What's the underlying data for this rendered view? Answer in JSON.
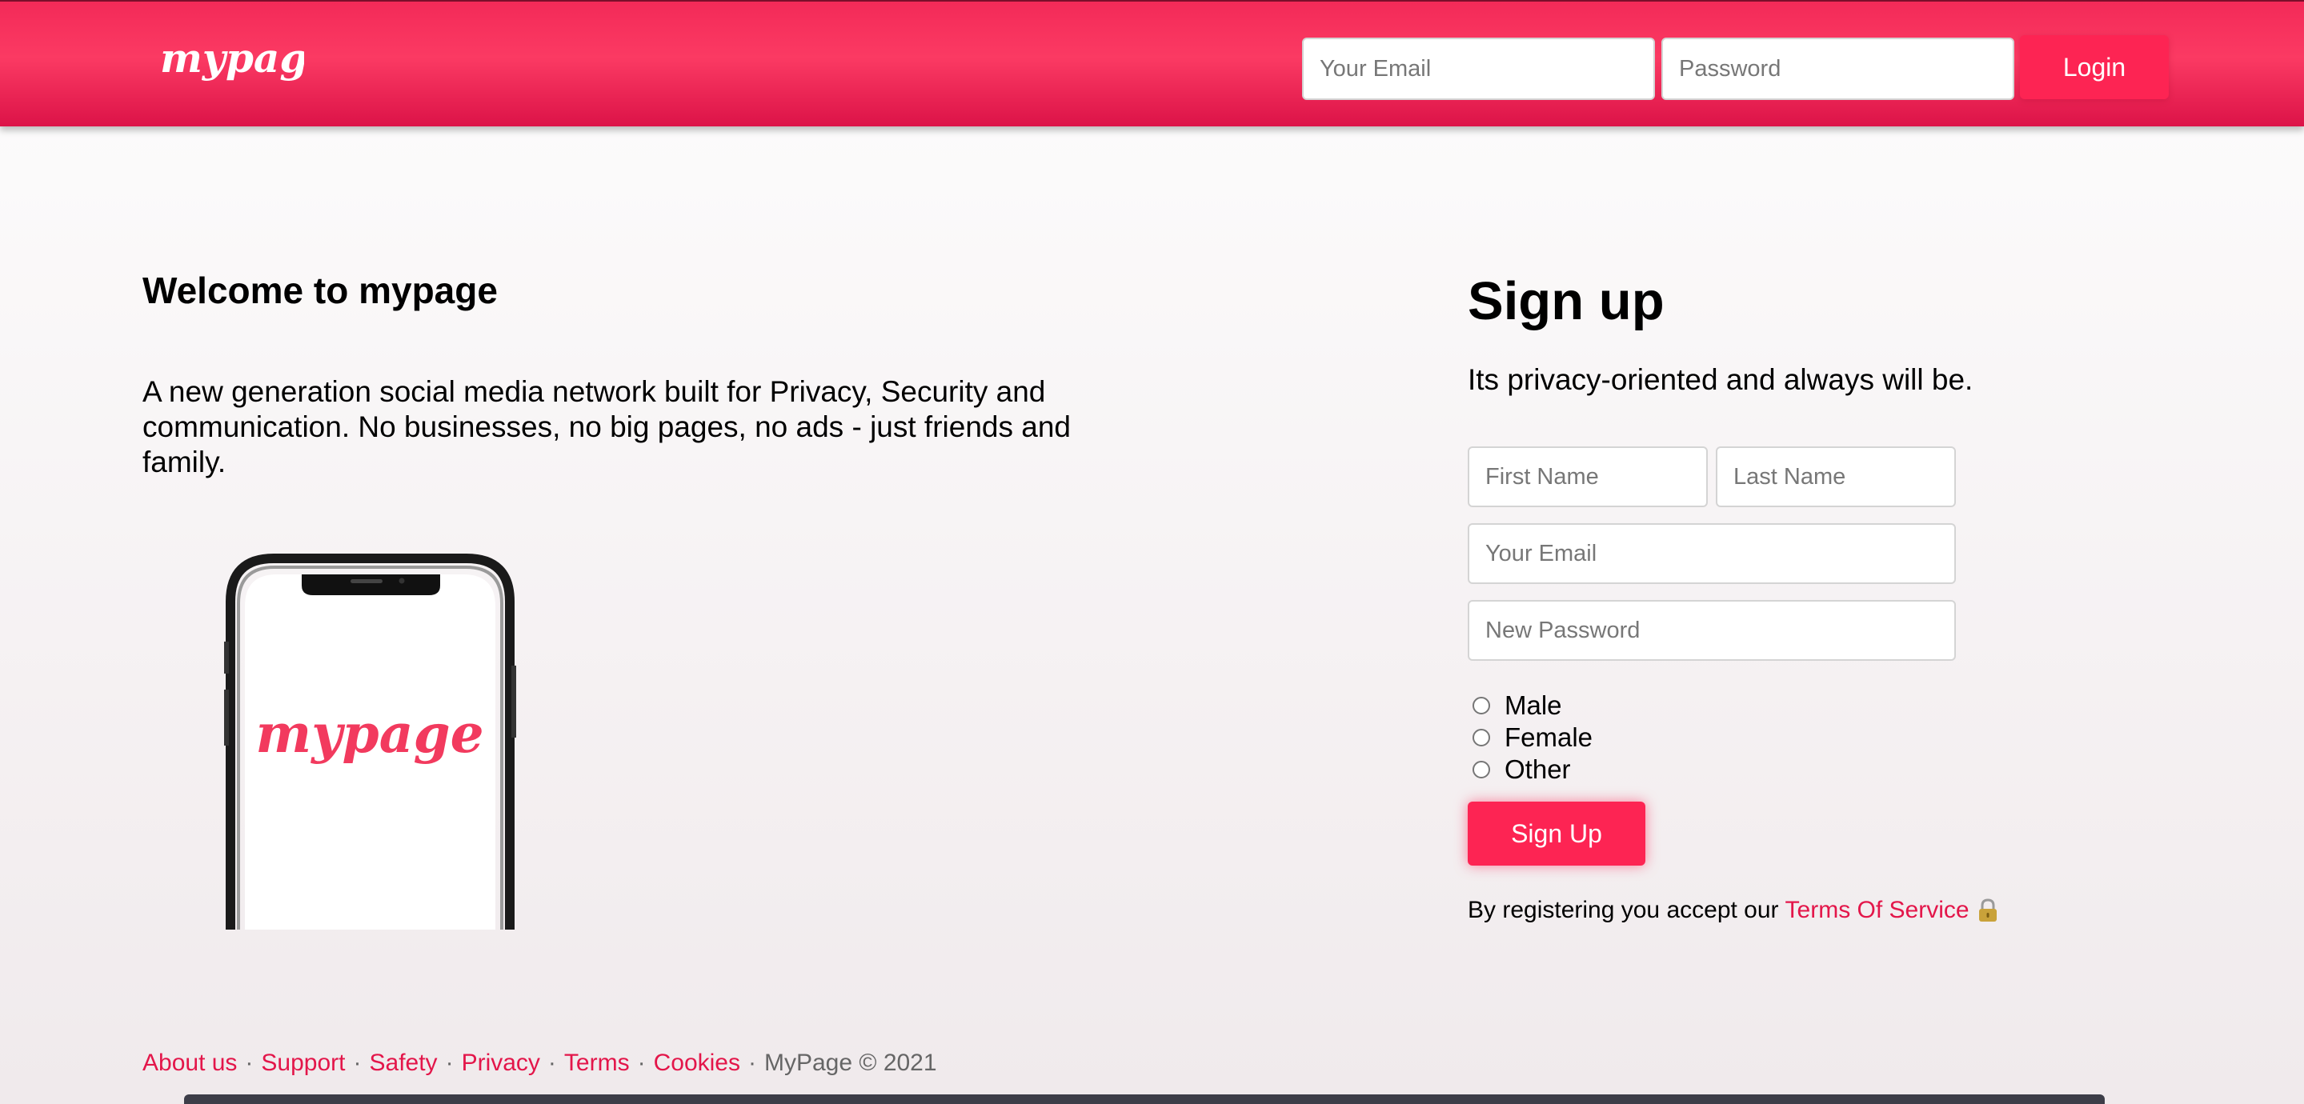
{
  "brand": {
    "logo_text": "mypage",
    "accent": "#fd2453",
    "link_color": "#e3164a",
    "header_color": "#f32a58"
  },
  "header": {
    "email_placeholder": "Your Email",
    "password_placeholder": "Password",
    "login_label": "Login"
  },
  "intro": {
    "title": "Welcome to mypage",
    "text": "A new generation social media network built for Privacy, Security and communication. No businesses, no big pages, no ads - just friends and family.",
    "phone_logo": "mypage"
  },
  "signup": {
    "title": "Sign up",
    "subtitle": "Its privacy-oriented and always will be.",
    "first_name_placeholder": "First Name",
    "last_name_placeholder": "Last Name",
    "email_placeholder": "Your Email",
    "password_placeholder": "New Password",
    "gender_options": [
      "Male",
      "Female",
      "Other"
    ],
    "button_label": "Sign Up",
    "terms_prefix": "By registering you accept our",
    "terms_link": "Terms Of Service",
    "terms_icon": "lock-icon"
  },
  "footer": {
    "links": [
      "About us",
      "Support",
      "Safety",
      "Privacy",
      "Terms",
      "Cookies"
    ],
    "separator": "·",
    "copyright": "MyPage © 2021"
  }
}
